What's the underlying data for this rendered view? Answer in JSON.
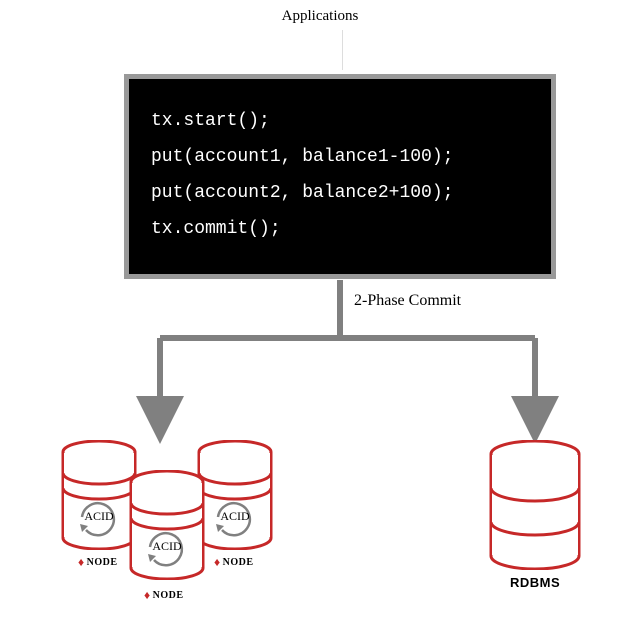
{
  "title": "Applications",
  "code": {
    "line1": "tx.start();",
    "line2": "put(account1, balance1-100);",
    "line3": "put(account2, balance2+100);",
    "line4": "tx.commit();"
  },
  "phase_label": "2-Phase Commit",
  "acid_label": "ACID",
  "node_labels": {
    "n1": "NODE",
    "n2": "NODE",
    "n3": "NODE"
  },
  "rdbms_label": "RDBMS",
  "colors": {
    "code_bg": "#000000",
    "code_border": "#999999",
    "arrow": "#808080",
    "db_stroke": "#c62828",
    "db_fill": "#ffffff"
  }
}
